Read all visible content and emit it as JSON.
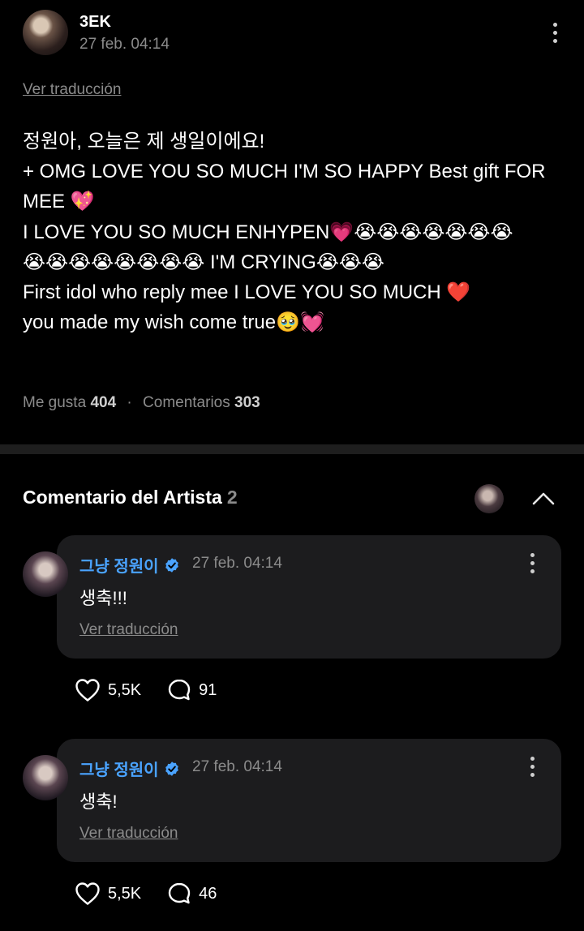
{
  "post": {
    "username": "3EK",
    "date": "27 feb. 04:14",
    "translate_label": "Ver traducción",
    "lines": [
      "정원아, 오늘은 제 생일이에요!",
      "+ OMG  LOVE YOU SO MUCH I'M SO HAPPY Best gift FOR",
      "MEE 💖",
      "I LOVE YOU SO MUCH ENHYPEN💗😭😭😭😭😭😭😭",
      "😭😭😭😭😭😭😭😭 I'M CRYING😭😭😭",
      "First idol who reply mee I LOVE YOU SO MUCH ❤️",
      "you made my wish come true🥹💓"
    ],
    "likes_label": "Me gusta",
    "likes_count": "404",
    "comments_label": "Comentarios",
    "comments_count": "303"
  },
  "artist_section": {
    "title": "Comentario del Artista",
    "count": "2"
  },
  "comments": [
    {
      "author": "그냥 정원이",
      "date": "27 feb. 04:14",
      "text": "생축!!!",
      "translate_label": "Ver traducción",
      "likes": "5,5K",
      "replies": "91"
    },
    {
      "author": "그냥 정원이",
      "date": "27 feb. 04:14",
      "text": "생축!",
      "translate_label": "Ver traducción",
      "likes": "5,5K",
      "replies": "46"
    }
  ],
  "icons": {
    "more": "more-vertical-icon",
    "collapse": "chevron-up-icon",
    "verified": "verified-badge-icon",
    "like": "heart-icon",
    "reply": "comment-bubble-icon"
  },
  "colors": {
    "background": "#000000",
    "card": "#1c1c1e",
    "accent": "#4aa3ff",
    "muted": "#8b8b8b"
  }
}
